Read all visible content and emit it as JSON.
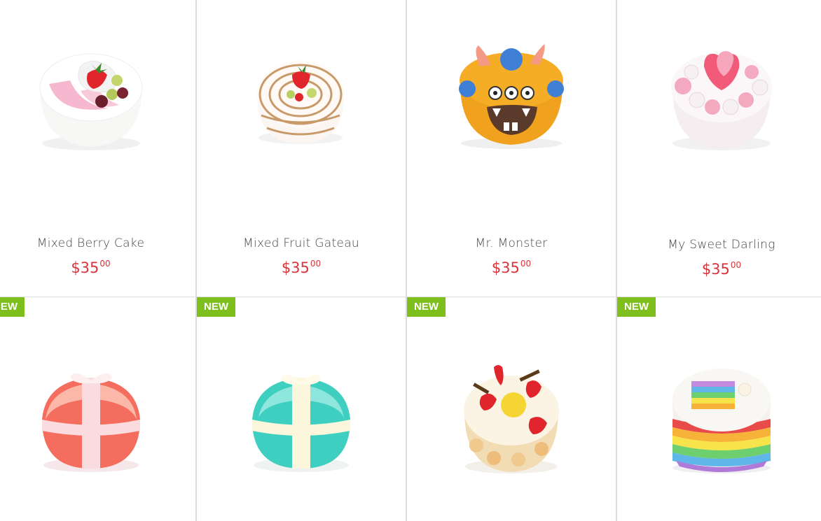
{
  "products_top": [
    {
      "name": "Mixed Berry Cake",
      "price_main": "$35",
      "price_cents": "00",
      "icon": "cake-white-berry-icon"
    },
    {
      "name": "Mixed Fruit Gateau",
      "price_main": "$35",
      "price_cents": "00",
      "icon": "cake-swirl-fruit-icon"
    },
    {
      "name": "Mr. Monster",
      "price_main": "$35",
      "price_cents": "00",
      "icon": "cake-monster-icon"
    },
    {
      "name": "My Sweet Darling",
      "price_main": "$35",
      "price_cents": "00",
      "icon": "cake-hearts-icon"
    }
  ],
  "products_bottom": [
    {
      "badge": "NEW",
      "icon": "cake-pink-gift-icon"
    },
    {
      "badge": "NEW",
      "icon": "cake-teal-gift-icon"
    },
    {
      "badge": "NEW",
      "icon": "cake-fruit-cream-icon"
    },
    {
      "badge": "NEW",
      "icon": "cake-rainbow-icon"
    }
  ],
  "colors": {
    "price": "#d9333a",
    "badge": "#7fbf1d",
    "divider": "#dcdcdc"
  }
}
